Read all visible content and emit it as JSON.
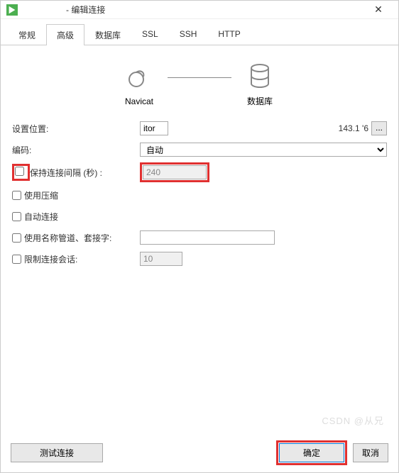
{
  "titlebar": {
    "title": " - 编辑连接"
  },
  "tabs": [
    {
      "label": "常规",
      "active": false
    },
    {
      "label": "高级",
      "active": true
    },
    {
      "label": "数据库",
      "active": false
    },
    {
      "label": "SSL",
      "active": false
    },
    {
      "label": "SSH",
      "active": false
    },
    {
      "label": "HTTP",
      "active": false
    }
  ],
  "diagram": {
    "left": "Navicat",
    "right": "数据库"
  },
  "form": {
    "location_label": "设置位置:",
    "location_value": "itor",
    "location_suffix": "143.1                '6",
    "browse": "...",
    "encoding_label": "编码:",
    "encoding_value": "自动",
    "keepalive_label": "保持连接间隔 (秒) :",
    "keepalive_value": "240",
    "compress_label": "使用压缩",
    "autoconnect_label": "自动连接",
    "pipe_label": "使用名称管道、套接字:",
    "pipe_value": "",
    "limit_label": "限制连接会话:",
    "limit_value": "10"
  },
  "footer": {
    "test": "测试连接",
    "ok": "确定",
    "cancel": "取消"
  },
  "watermark": "CSDN @从兄"
}
